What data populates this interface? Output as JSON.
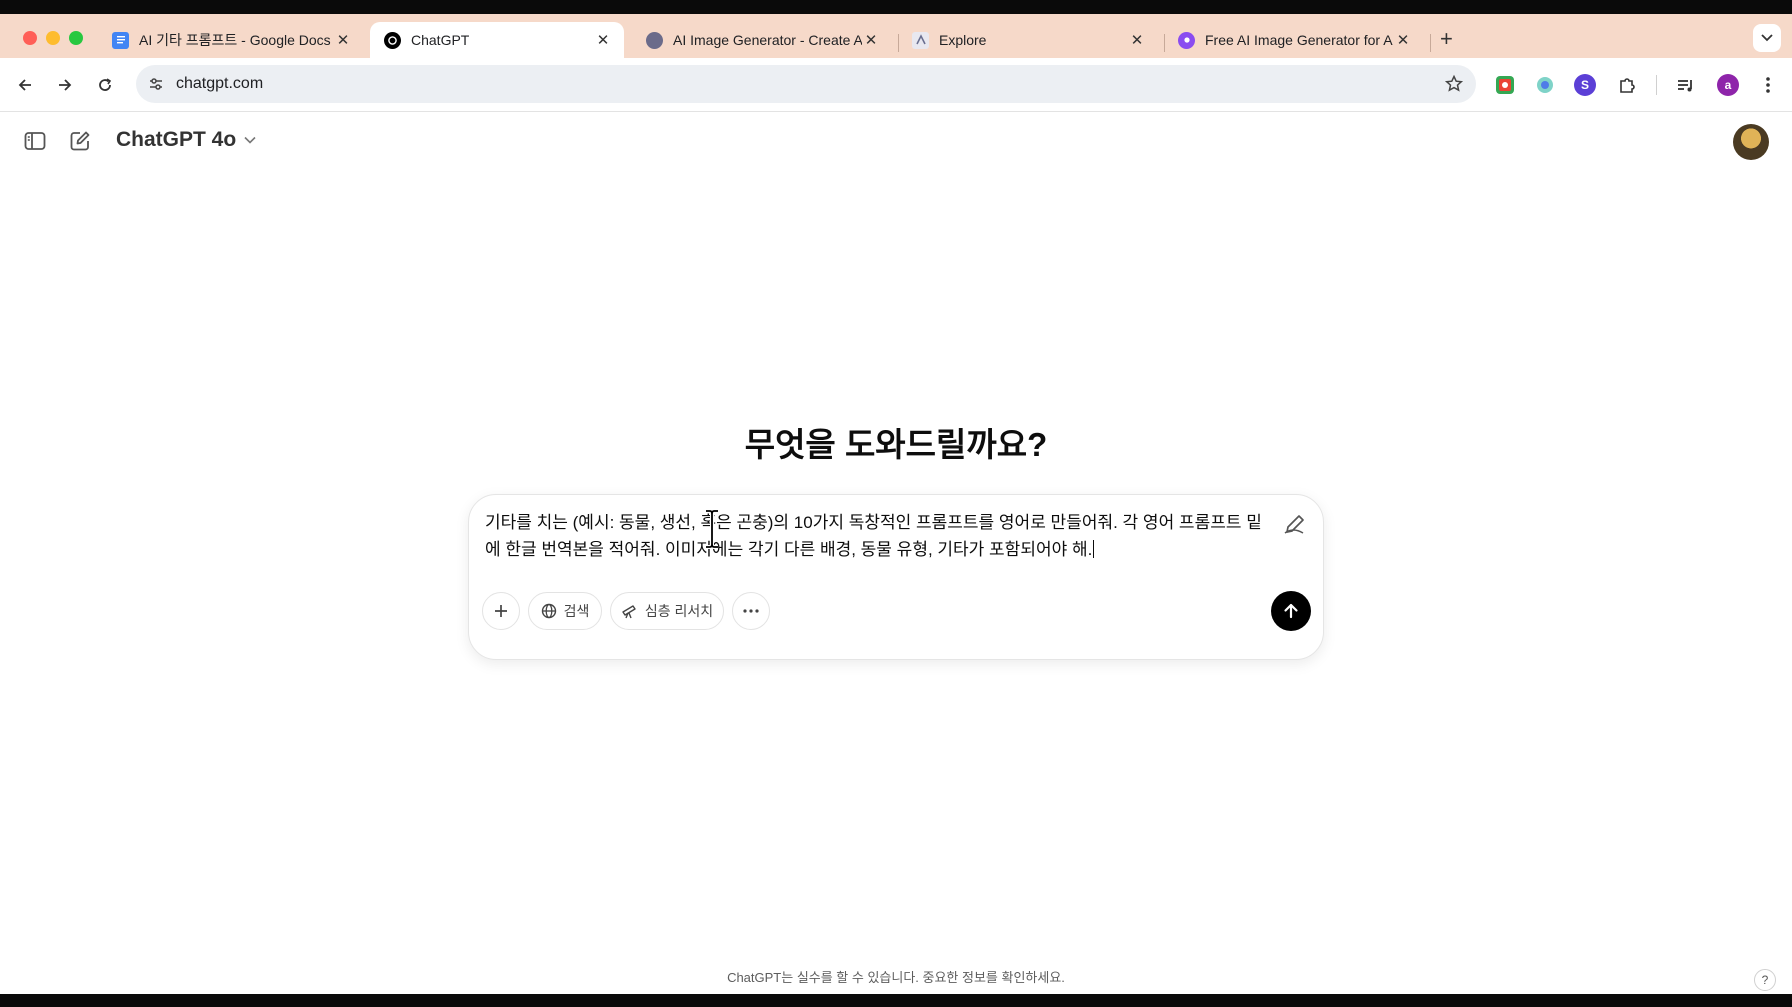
{
  "browser": {
    "tabs": [
      {
        "title": "AI 기타 프롬프트 - Google Docs",
        "favicon": "google-docs-icon",
        "color": "#4285f4"
      },
      {
        "title": "ChatGPT",
        "favicon": "openai-icon",
        "color": "#000000"
      },
      {
        "title": "AI Image Generator - Create A",
        "favicon": "ai-generator-icon",
        "color": "#6b6b8a"
      },
      {
        "title": "Explore",
        "favicon": "explore-icon",
        "color": "#8a8fa8"
      },
      {
        "title": "Free AI Image Generator for A",
        "favicon": "image-generator-icon",
        "color": "#8a4cf0"
      }
    ],
    "active_tab": 1,
    "url": "chatgpt.com",
    "profile_initial": "a",
    "accent": "#f6d9c9"
  },
  "app": {
    "model_name": "ChatGPT 4o",
    "headline": "무엇을 도와드릴까요?",
    "prompt_text": "기타를 치는 (예시: 동물, 생선, 혹은 곤충)의 10가지 독창적인 프롬프트를 영어로 만들어줘. 각 영어 프롬프트 밑에 한글 번역본을 적어줘. 이미지에는 각기 다른 배경, 동물 유형, 기타가 포함되어야 해.",
    "tools": {
      "search_label": "검색",
      "deep_research_label": "심층 리서치"
    },
    "footer_note": "ChatGPT는 실수를 할 수 있습니다. 중요한 정보를 확인하세요.",
    "help_label": "?"
  }
}
